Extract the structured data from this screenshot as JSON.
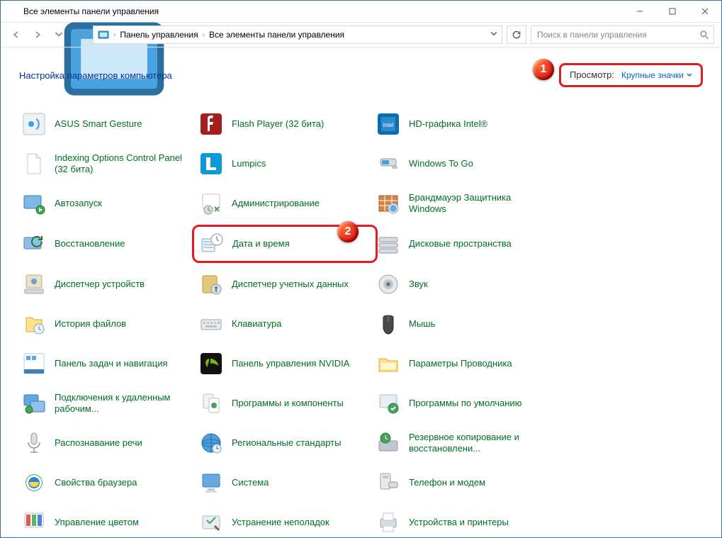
{
  "window_title": "Все элементы панели управления",
  "breadcrumb": {
    "root": "Панель управления",
    "current": "Все элементы панели управления"
  },
  "search": {
    "placeholder": "Поиск в панели управления"
  },
  "header": {
    "page_title": "Настройка параметров компьютера",
    "view_label": "Просмотр:",
    "view_value": "Крупные значки"
  },
  "badges": {
    "one": "1",
    "two": "2"
  },
  "items": {
    "col1": [
      {
        "name": "asus-smart-gesture",
        "label": "ASUS Smart Gesture",
        "icon": "gesture"
      },
      {
        "name": "indexing-options",
        "label": "Indexing Options Control Panel (32 бита)",
        "icon": "doc"
      },
      {
        "name": "autoplay",
        "label": "Автозапуск",
        "icon": "autoplay"
      },
      {
        "name": "recovery",
        "label": "Восстановление",
        "icon": "recovery"
      },
      {
        "name": "device-manager",
        "label": "Диспетчер устройств",
        "icon": "devmgr"
      },
      {
        "name": "file-history",
        "label": "История файлов",
        "icon": "filehist"
      },
      {
        "name": "taskbar-nav",
        "label": "Панель задач и навигация",
        "icon": "taskbar"
      },
      {
        "name": "remote-desktop",
        "label": "Подключения к удаленным рабочим...",
        "icon": "rdp"
      },
      {
        "name": "speech",
        "label": "Распознавание речи",
        "icon": "mic"
      },
      {
        "name": "internet-options",
        "label": "Свойства браузера",
        "icon": "ie"
      },
      {
        "name": "color-management",
        "label": "Управление цветом",
        "icon": "color"
      }
    ],
    "col2": [
      {
        "name": "flash-player",
        "label": "Flash Player (32 бита)",
        "icon": "flash"
      },
      {
        "name": "lumpics",
        "label": "Lumpics",
        "icon": "lumpics"
      },
      {
        "name": "admin-tools",
        "label": "Администрирование",
        "icon": "admin"
      },
      {
        "name": "date-time",
        "label": "Дата и время",
        "icon": "clock",
        "highlight": true
      },
      {
        "name": "credential-manager",
        "label": "Диспетчер учетных данных",
        "icon": "cred"
      },
      {
        "name": "keyboard",
        "label": "Клавиатура",
        "icon": "kbd"
      },
      {
        "name": "nvidia",
        "label": "Панель управления NVIDIA",
        "icon": "nvidia"
      },
      {
        "name": "programs-features",
        "label": "Программы и компоненты",
        "icon": "progs"
      },
      {
        "name": "region",
        "label": "Региональные стандарты",
        "icon": "globe"
      },
      {
        "name": "system",
        "label": "Система",
        "icon": "system"
      },
      {
        "name": "troubleshoot",
        "label": "Устранение неполадок",
        "icon": "trouble"
      }
    ],
    "col3": [
      {
        "name": "intel-graphics",
        "label": "HD-графика Intel®",
        "icon": "intel"
      },
      {
        "name": "windows-to-go",
        "label": "Windows To Go",
        "icon": "wtg"
      },
      {
        "name": "firewall",
        "label": "Брандмауэр Защитника Windows",
        "icon": "firewall"
      },
      {
        "name": "storage-spaces",
        "label": "Дисковые пространства",
        "icon": "storage"
      },
      {
        "name": "sound",
        "label": "Звук",
        "icon": "sound"
      },
      {
        "name": "mouse",
        "label": "Мышь",
        "icon": "mouse"
      },
      {
        "name": "folder-options",
        "label": "Параметры Проводника",
        "icon": "explorer"
      },
      {
        "name": "default-programs",
        "label": "Программы по умолчанию",
        "icon": "defprogs"
      },
      {
        "name": "backup",
        "label": "Резервное копирование и восстановлени...",
        "icon": "backup"
      },
      {
        "name": "phone-modem",
        "label": "Телефон и модем",
        "icon": "phone"
      },
      {
        "name": "devices-printers",
        "label": "Устройства и принтеры",
        "icon": "printer"
      }
    ]
  }
}
